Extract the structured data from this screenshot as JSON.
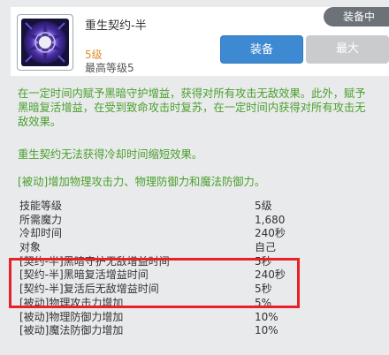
{
  "skill": {
    "name": "重生契约-半",
    "level": "5级",
    "max_level": "最高等级5",
    "equipped_badge": "装备中",
    "equip_button": "装备",
    "max_button": "最大"
  },
  "description": {
    "lines": [
      "在一定时间内赋予黑暗守护增益，获得对所有攻击无敌效果。此外，赋予",
      "黑暗复活增益，在受到致命攻击时复苏，在一定时间内获得对所有攻击无",
      "敌效果。"
    ],
    "note": "重生契约无法获得冷却时间缩短效果。",
    "passive": "[被动]增加物理攻击力、物理防御力和魔法防御力。"
  },
  "stats": [
    {
      "label": "技能等级",
      "value": "5级"
    },
    {
      "label": "所需魔力",
      "value": "1,680"
    },
    {
      "label": "冷却时间",
      "value": "240秒"
    },
    {
      "label": "对象",
      "value": "自己"
    },
    {
      "label": "[契约-半]黑暗守护无敌增益时间",
      "value": "5秒"
    },
    {
      "label": "[契约-半]黑暗复活增益时间",
      "value": "240秒"
    },
    {
      "label": "[契约-半]复活后无敌增益时间",
      "value": "5秒"
    },
    {
      "label": "[被动]物理攻击力增加",
      "value": "5%"
    },
    {
      "label": "[被动]物理防御力增加",
      "value": "10%"
    },
    {
      "label": "[被动]魔法防御力增加",
      "value": "10%"
    }
  ],
  "colors": {
    "accent_green": "#4aa02b",
    "highlight_red": "#e8212b",
    "equip_blue": "#3e8ad2",
    "level_orange": "#e08c2a"
  }
}
